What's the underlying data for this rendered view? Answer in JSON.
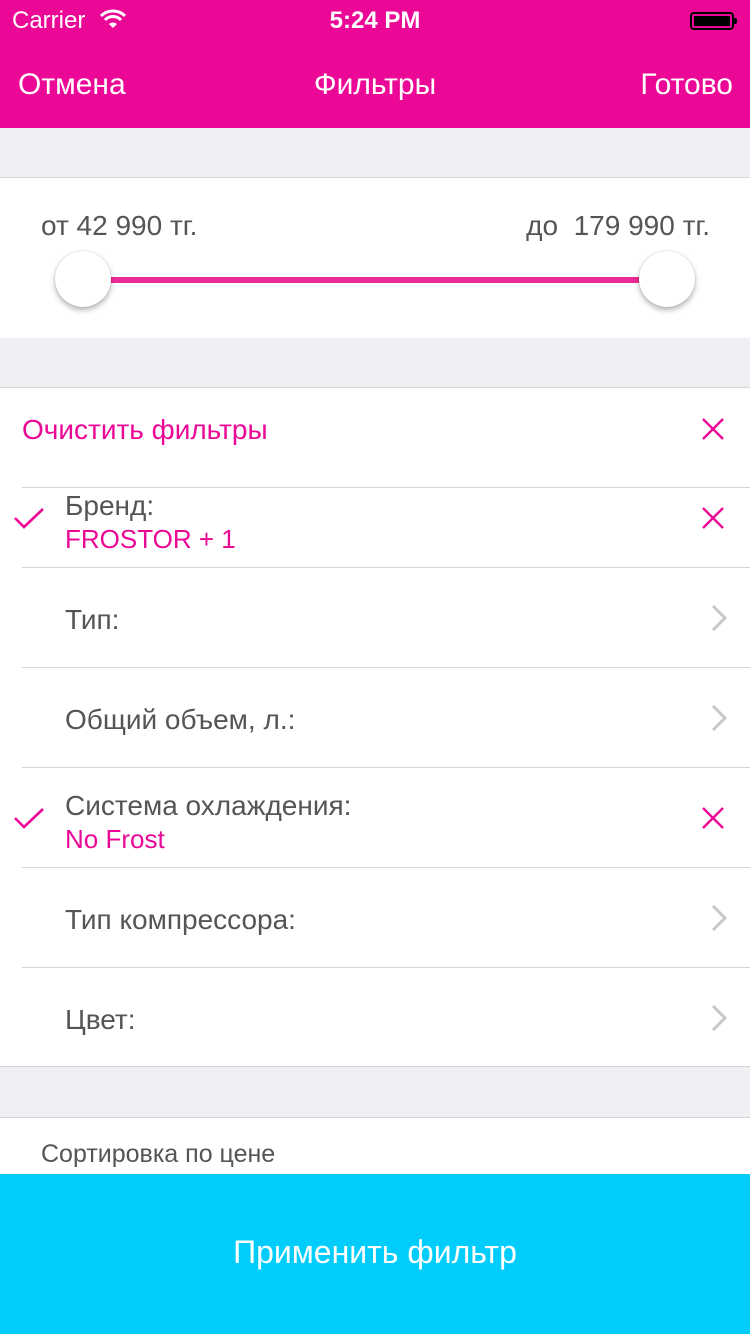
{
  "status_bar": {
    "carrier": "Carrier",
    "time": "5:24 PM"
  },
  "nav": {
    "cancel": "Отмена",
    "title": "Фильтры",
    "done": "Готово"
  },
  "price": {
    "from_label": "от 42 990 тг.",
    "to_label": "до  179 990 тг."
  },
  "filters": {
    "clear_label": "Очистить фильтры",
    "items": [
      {
        "label": "Бренд:",
        "value": "FROSTOR + 1",
        "selected": true
      },
      {
        "label": "Тип:"
      },
      {
        "label": "Общий объем, л.:"
      },
      {
        "label": "Система охлаждения:",
        "value": "No Frost",
        "selected": true
      },
      {
        "label": "Тип компрессора:"
      },
      {
        "label": "Цвет:"
      }
    ]
  },
  "sort": {
    "label": "Сортировка по цене"
  },
  "apply_button": {
    "label": "Применить фильтр"
  },
  "colors": {
    "accent": "#ec0896",
    "apply": "#00cdfc",
    "background": "#efeff4"
  },
  "icons": {
    "selected": "checkmark-icon",
    "remove": "close-icon",
    "disclosure": "chevron-right-icon"
  }
}
